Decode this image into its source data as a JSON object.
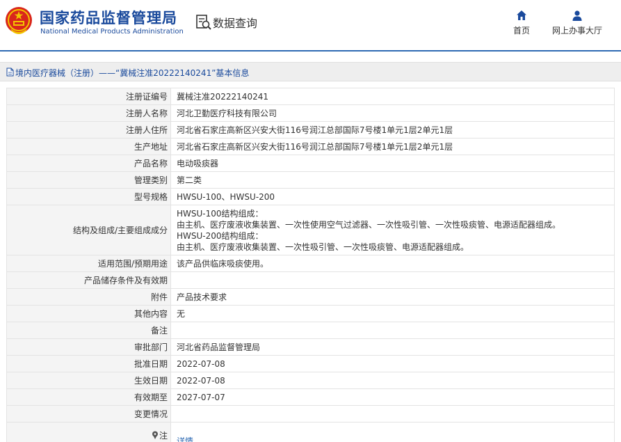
{
  "header": {
    "brand_cn": "国家药品监督管理局",
    "brand_en": "National Medical Products Administration",
    "query_title": "数据查询",
    "nav": {
      "home": "首页",
      "online": "网上办事大厅"
    }
  },
  "breadcrumb": {
    "text": "境内医疗器械（注册）——“冀械注准20222140241”基本信息"
  },
  "rows": [
    {
      "label": "注册证编号",
      "value": "冀械注准20222140241"
    },
    {
      "label": "注册人名称",
      "value": "河北卫勤医疗科技有限公司"
    },
    {
      "label": "注册人住所",
      "value": "河北省石家庄高新区兴安大街116号润江总部国际7号楼1单元1层2单元1层"
    },
    {
      "label": "生产地址",
      "value": "河北省石家庄高新区兴安大街116号润江总部国际7号楼1单元1层2单元1层"
    },
    {
      "label": "产品名称",
      "value": "电动吸痰器"
    },
    {
      "label": "管理类别",
      "value": "第二类"
    },
    {
      "label": "型号规格",
      "value": "HWSU-100、HWSU-200"
    },
    {
      "label": "结构及组成/主要组成成分",
      "value": "HWSU-100结构组成：\n由主机、医疗废液收集装置、一次性使用空气过滤器、一次性吸引管、一次性吸痰管、电源适配器组成。\nHWSU-200结构组成：\n由主机、医疗废液收集装置、一次性吸引管、一次性吸痰管、电源适配器组成。"
    },
    {
      "label": "适用范围/预期用途",
      "value": "该产品供临床吸痰使用。"
    },
    {
      "label": "产品储存条件及有效期",
      "value": ""
    },
    {
      "label": "附件",
      "value": "产品技术要求"
    },
    {
      "label": "其他内容",
      "value": "无"
    },
    {
      "label": "备注",
      "value": ""
    },
    {
      "label": "审批部门",
      "value": "河北省药品监督管理局"
    },
    {
      "label": "批准日期",
      "value": "2022-07-08"
    },
    {
      "label": "生效日期",
      "value": "2022-07-08"
    },
    {
      "label": "有效期至",
      "value": "2027-07-07"
    },
    {
      "label": "变更情况",
      "value": ""
    }
  ],
  "note": {
    "label": "注",
    "link": "详情"
  },
  "colors": {
    "brand_blue": "#1a4a9c",
    "accent_blue": "#2d6ab3",
    "emblem_red": "#d9261c",
    "emblem_gold": "#f2c400",
    "label_bg": "#f4f4f4",
    "breadcrumb_bg": "#eeeeee"
  },
  "icons": {
    "emblem": "national-emblem-icon",
    "query": "search-document-icon",
    "home": "home-icon",
    "online": "user-icon",
    "breadcrumb": "document-icon",
    "note": "info-pin-icon"
  }
}
